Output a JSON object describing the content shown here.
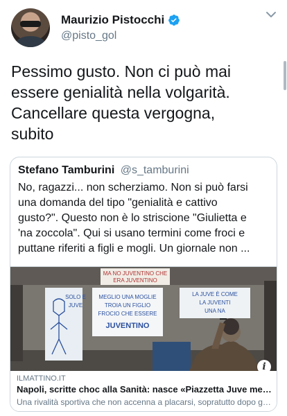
{
  "tweet": {
    "author": {
      "name": "Maurizio Pistocchi",
      "handle": "@pisto_gol"
    },
    "text": "Pessimo gusto. Non ci può mai\nessere genialità nella volgarità.\nCancellare questa vergogna,\nsubito"
  },
  "quoted_tweet": {
    "author": {
      "name": "Stefano Tamburini",
      "handle": "@s_tamburini"
    },
    "text": "No, ragazzi... non scherziamo. Non si può farsi\nuna domanda del tipo \"genialità e cattivo\ngusto?\". Questo non è lo striscione \"Giulietta e\n'na zoccola\". Qui si usano termini come froci e\nputtane riferiti a figli e mogli. Un giornale non ...",
    "card": {
      "domain": "ILMATTINO.IT",
      "title": "Napoli, scritte choc alla Sanità: nasce «Piazzetta Juve merda»",
      "description": "Una rivalità sportiva che non accenna a placarsi, sopratutto dopo gli...",
      "image_banners": {
        "top": "MA NO JUVENTINO CHE\nERA JUVENTINO",
        "left": "SOLO E\nJUVE",
        "center": "MEGLIO UNA MOGLIE\nTROIA UN FIGLIO\nFROCIO CHE ESSERE\nJUVENTINO",
        "right": "LA JUVE È COME\nLA JUVENTI\nUNA NA"
      }
    }
  },
  "icons": {
    "verified": "verified-badge-icon",
    "menu": "chevron-down-icon",
    "info": "info-icon"
  },
  "colors": {
    "verified": "#1da1f2",
    "secondary_text": "#657786",
    "border": "#ccd6dd"
  }
}
